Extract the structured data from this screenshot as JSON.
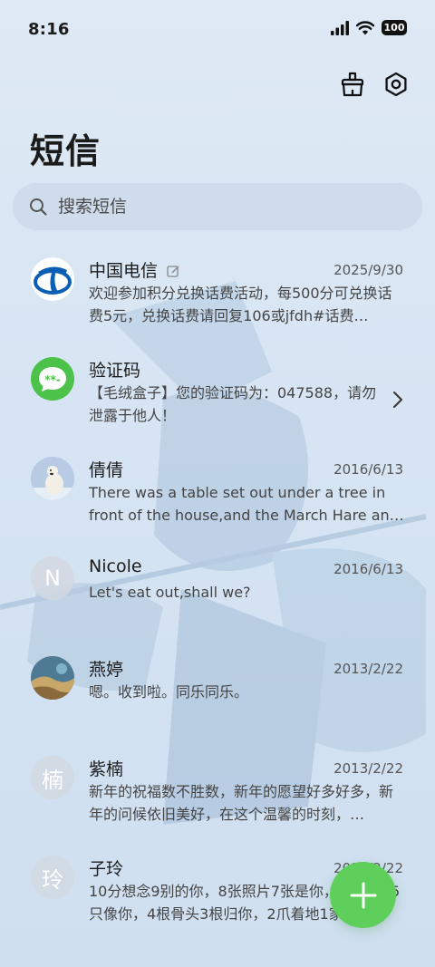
{
  "status": {
    "time": "8:16",
    "battery": "100"
  },
  "header": {
    "title": "短信"
  },
  "search": {
    "placeholder": "搜索短信"
  },
  "messages": [
    {
      "name": "中国电信",
      "date": "2025/9/30",
      "preview": "欢迎参加积分兑换话费活动，每500分可兑换话费5元，兑换话费请回复106或jfdh#话费…",
      "avatar": "china-telecom-logo",
      "edited": true
    },
    {
      "name": "验证码",
      "date": "",
      "preview": "【毛绒盒子】您的验证码为：047588，请勿泄露于他人！",
      "avatar": "sms-code-icon"
    },
    {
      "name": "倩倩",
      "date": "2016/6/13",
      "preview": "There was a table set out under a tree in front of the house,and the March Hare an…",
      "avatar": "polar-bear-photo"
    },
    {
      "name": "Nicole",
      "date": "2016/6/13",
      "preview": "Let's eat out,shall we?",
      "avatar_letter": "N"
    },
    {
      "name": "燕婷",
      "date": "2013/2/22",
      "preview": "嗯。收到啦。同乐同乐。",
      "avatar": "landscape-photo"
    },
    {
      "name": "紫楠",
      "date": "2013/2/22",
      "preview": "新年的祝福数不胜数，新年的愿望好多好多，新年的问候依旧美好，在这个温馨的时刻，…",
      "avatar_letter": "楠"
    },
    {
      "name": "子玲",
      "date": "2013/2/22",
      "preview": "10分想念9别的你，8张照片7张是你，6只小狗5只像你，4根骨头3根归你，2爪着地1家…",
      "avatar_letter": "玲"
    }
  ],
  "colors": {
    "fab": "#5fcf5c",
    "telecom_blue": "#0a5fb4",
    "sms_green": "#4cc24a"
  },
  "icons": [
    "broom-icon",
    "settings-icon",
    "search-icon",
    "plus-icon",
    "chevron-right-icon"
  ]
}
